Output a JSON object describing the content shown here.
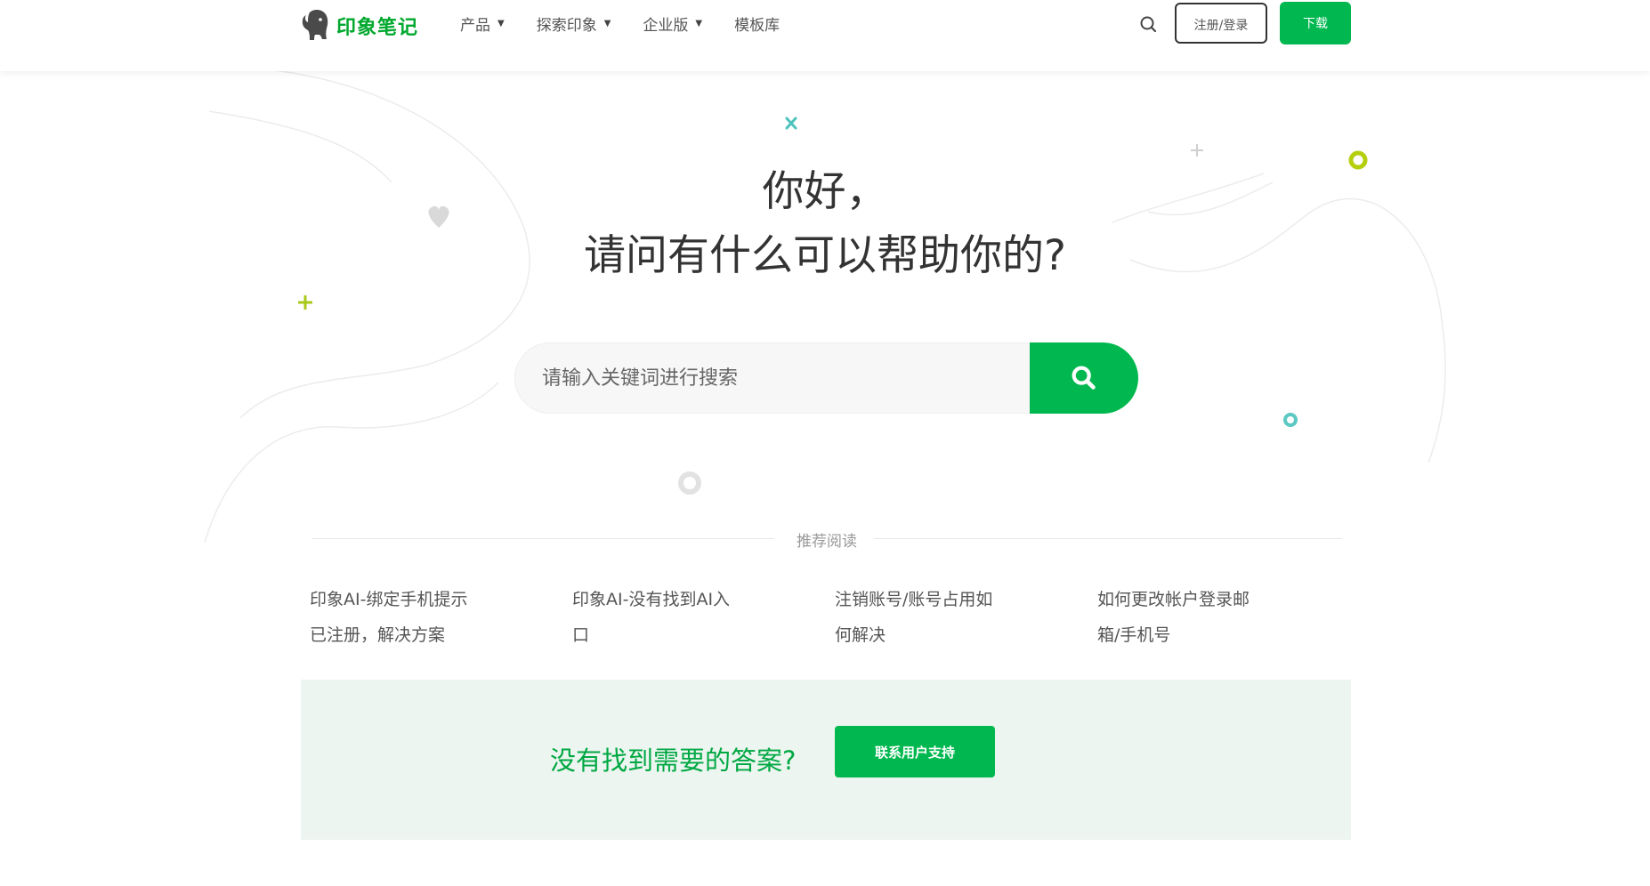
{
  "header": {
    "logo_text": "印象笔记",
    "nav": [
      {
        "label": "产品",
        "has_dropdown": true
      },
      {
        "label": "探索印象",
        "has_dropdown": true
      },
      {
        "label": "企业版",
        "has_dropdown": true
      },
      {
        "label": "模板库",
        "has_dropdown": false
      }
    ],
    "search_icon": "search-icon",
    "login_label": "注册/登录",
    "download_label": "下载"
  },
  "hero": {
    "line1": "你好，",
    "line2": "请问有什么可以帮助你的?"
  },
  "search": {
    "placeholder": "请输入关键词进行搜索",
    "value": ""
  },
  "recommended": {
    "label": "推荐阅读",
    "articles": [
      {
        "line1": "印象AI-绑定手机提示",
        "line2": "已注册，解决方案"
      },
      {
        "line1": "印象AI-没有找到AI入",
        "line2": "口"
      },
      {
        "line1": "注销账号/账号占用如",
        "line2": "何解决"
      },
      {
        "line1": "如何更改帐户登录邮",
        "line2": "箱/手机号"
      }
    ]
  },
  "support": {
    "text": "没有找到需要的答案?",
    "button_label": "联系用户支持"
  },
  "colors": {
    "brand_green": "#00b84f",
    "text_green": "#00a842",
    "support_bg": "#ecf5f0"
  }
}
